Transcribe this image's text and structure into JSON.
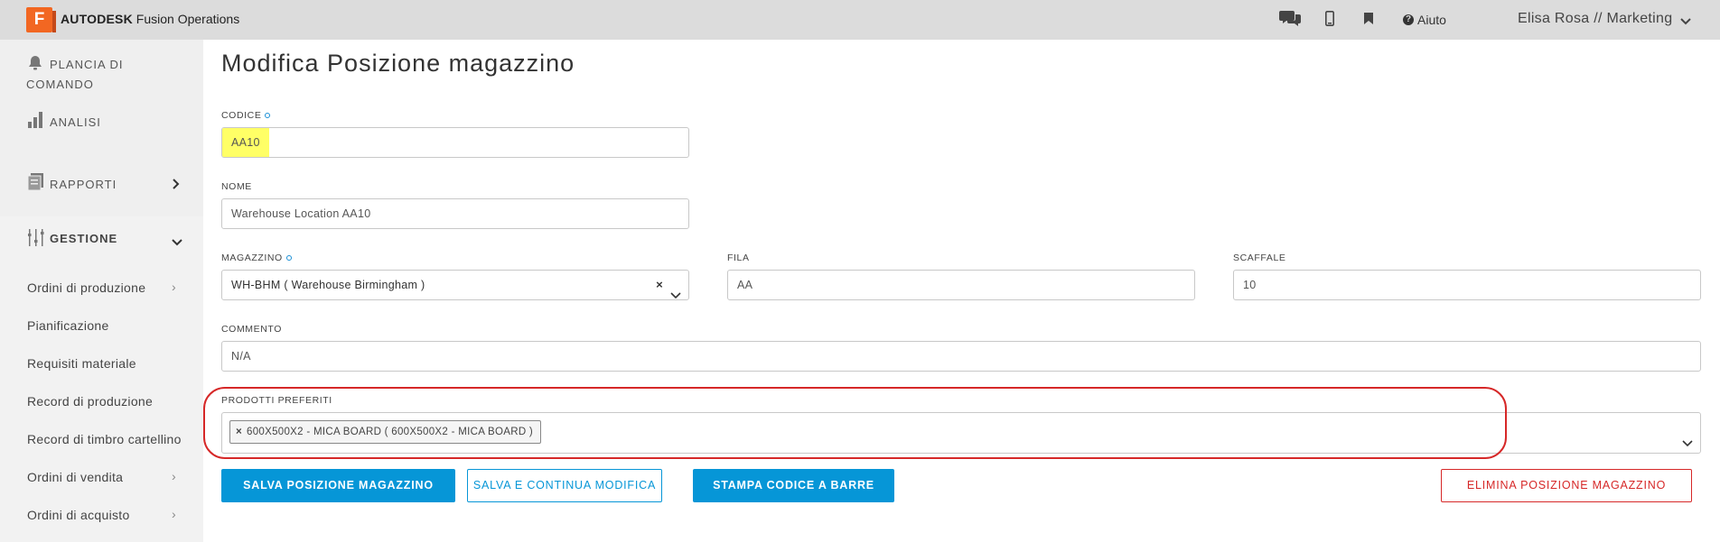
{
  "header": {
    "logo_letter": "F",
    "brand_bold": "AUTODESK",
    "brand_rest": " Fusion Operations",
    "help_label": "Aiuto",
    "user_label": "Elisa Rosa // Marketing"
  },
  "sidebar": {
    "dashboard_line1": "PLANCIA DI",
    "dashboard_line2": "COMANDO",
    "analytics": "ANALISI",
    "reports": "RAPPORTI",
    "management": "GESTIONE",
    "sub_items": [
      "Ordini di produzione",
      "Pianificazione",
      "Requisiti materiale",
      "Record di produzione",
      "Record di timbro cartellino",
      "Ordini di vendita",
      "Ordini di acquisto"
    ]
  },
  "page": {
    "title": "Modifica Posizione magazzino"
  },
  "form": {
    "code_label": "CODICE",
    "code_value": "AA10",
    "name_label": "NOME",
    "name_value": "Warehouse Location AA10",
    "warehouse_label": "MAGAZZINO",
    "warehouse_value": "WH-BHM ( Warehouse Birmingham )",
    "row_label": "FILA",
    "row_value": "AA",
    "shelf_label": "SCAFFALE",
    "shelf_value": "10",
    "comment_label": "COMMENTO",
    "comment_value": "N/A",
    "preferred_label": "PRODOTTI PREFERITI",
    "preferred_tag": "600X500X2 - MICA BOARD ( 600X500X2 - MICA BOARD )",
    "tag_remove": "×",
    "clear_mark": "×"
  },
  "buttons": {
    "save": "SALVA POSIZIONE MAGAZZINO",
    "save_continue": "SALVA E CONTINUA MODIFICA",
    "print_barcode": "STAMPA CODICE A BARRE",
    "delete": "ELIMINA POSIZIONE MAGAZZINO"
  },
  "colors": {
    "accent": "#0696d7",
    "danger": "#d62828",
    "highlight": "#ffff66",
    "logo": "#f26722"
  }
}
